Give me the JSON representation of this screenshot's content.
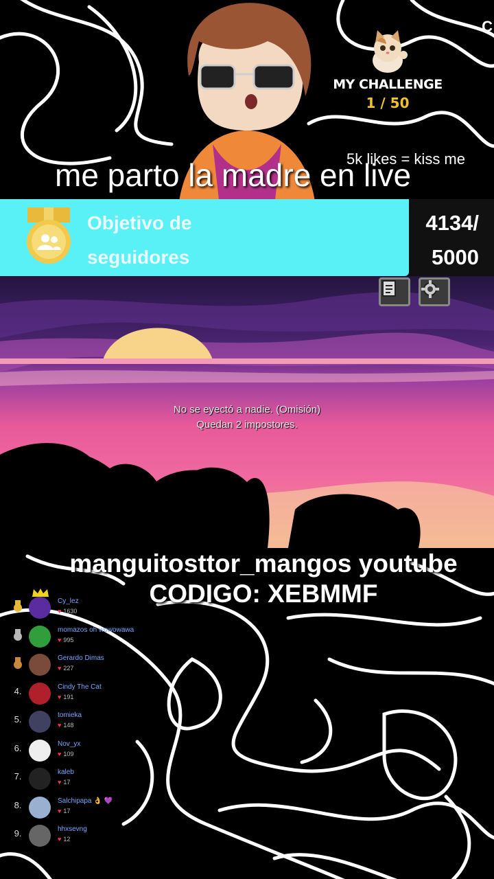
{
  "stream_title": "me parto la madre en live",
  "likes_text": "5k likes = kiss me",
  "corner_text": "C",
  "challenge": {
    "title": "MY CHALLENGE",
    "progress": "1 / 50"
  },
  "follower_goal": {
    "label_line1": "Objetivo de",
    "label_line2": "seguidores",
    "count_line1": "4134/",
    "count_line2": "5000",
    "current": 4134,
    "target": 5000,
    "fill_color": "#59f0f6"
  },
  "game": {
    "eject_line1": "No se eyectó a nadie. (Omisión)",
    "eject_line2": "Quedan 2 impostores.",
    "buttons": [
      "notes-icon",
      "gear-icon"
    ]
  },
  "info": {
    "youtube_line": "manguitosttor_mangos youtube",
    "code_line": "CODIGO: XEBMMF"
  },
  "leaderboard": [
    {
      "rank": "",
      "medal": "gold",
      "name": "Cy_lez",
      "score": "1630",
      "avatar_color": "#5a2ca0"
    },
    {
      "rank": "",
      "medal": "silver",
      "name": "momazos oh wowowawa",
      "score": "995",
      "avatar_color": "#2f9e3b"
    },
    {
      "rank": "",
      "medal": "bronze",
      "name": "Gerardo Dimas",
      "score": "227",
      "avatar_color": "#7a4a3a"
    },
    {
      "rank": "4.",
      "medal": "",
      "name": "Cindy The Cat",
      "score": "191",
      "avatar_color": "#b0202a"
    },
    {
      "rank": "5.",
      "medal": "",
      "name": "tomieka",
      "score": "148",
      "avatar_color": "#404060"
    },
    {
      "rank": "6.",
      "medal": "",
      "name": "Nov_yx",
      "score": "109",
      "avatar_color": "#eeeeee"
    },
    {
      "rank": "7.",
      "medal": "",
      "name": "kaleb",
      "score": "17",
      "avatar_color": "#222222"
    },
    {
      "rank": "8.",
      "medal": "",
      "name": "Salchipapa 👌 💜",
      "score": "17",
      "avatar_color": "#9ab0d0"
    },
    {
      "rank": "9.",
      "medal": "",
      "name": "hhxsevng",
      "score": "12",
      "avatar_color": "#666666"
    }
  ]
}
